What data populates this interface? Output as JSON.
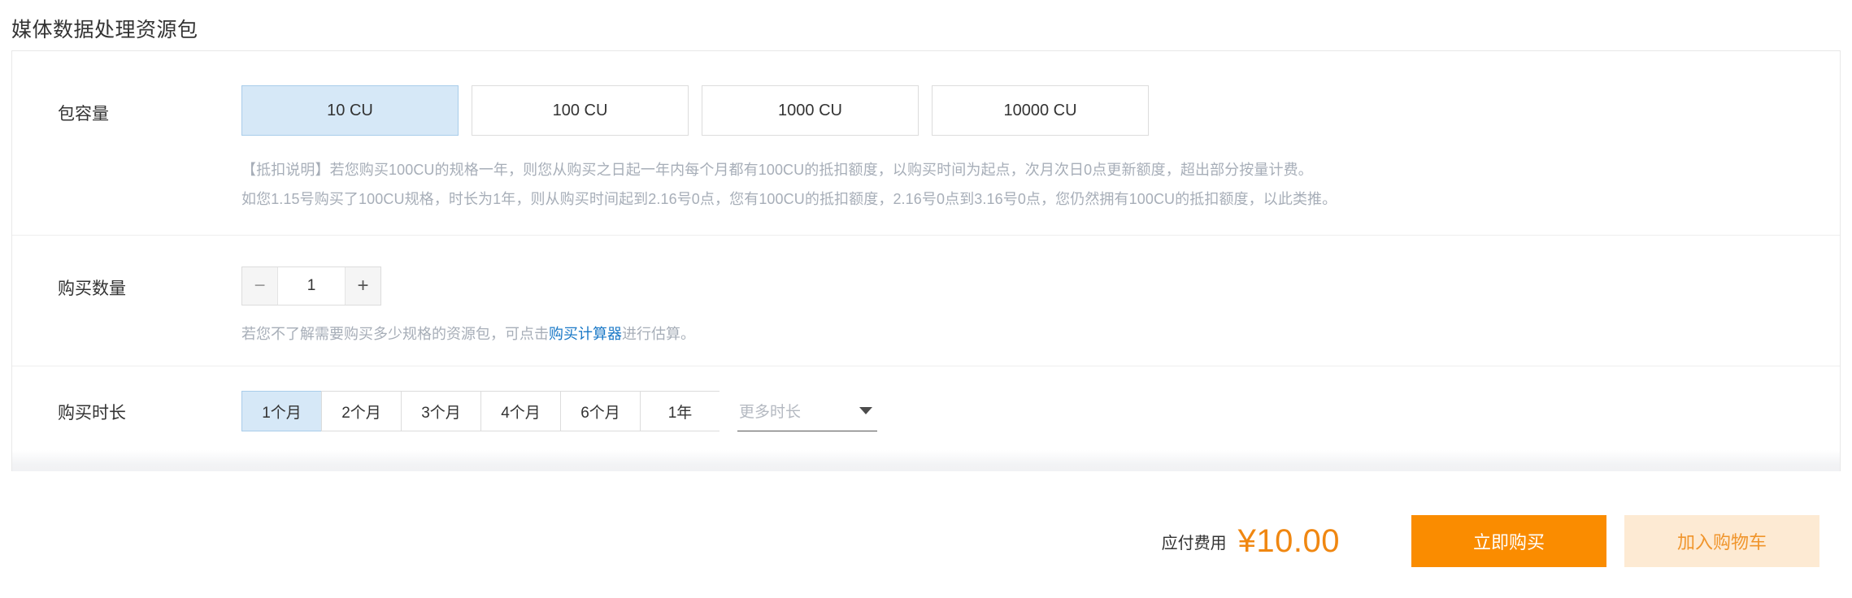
{
  "page": {
    "title": "媒体数据处理资源包"
  },
  "capacity": {
    "label": "包容量",
    "options": [
      {
        "label": "10 CU",
        "selected": true
      },
      {
        "label": "100 CU",
        "selected": false
      },
      {
        "label": "1000 CU",
        "selected": false
      },
      {
        "label": "10000 CU",
        "selected": false
      }
    ],
    "description_line1": "【抵扣说明】若您购买100CU的规格一年，则您从购买之日起一年内每个月都有100CU的抵扣额度，以购买时间为起点，次月次日0点更新额度，超出部分按量计费。",
    "description_line2": "如您1.15号购买了100CU规格，时长为1年，则从购买时间起到2.16号0点，您有100CU的抵扣额度，2.16号0点到3.16号0点，您仍然拥有100CU的抵扣额度，以此类推。"
  },
  "quantity": {
    "label": "购买数量",
    "value": "1",
    "decrease_icon": "minus-icon",
    "increase_icon": "plus-icon",
    "hint_prefix": "若您不了解需要购买多少规格的资源包，可点击",
    "hint_link": "购买计算器",
    "hint_suffix": "进行估算。"
  },
  "duration": {
    "label": "购买时长",
    "options": [
      {
        "label": "1个月",
        "selected": true
      },
      {
        "label": "2个月",
        "selected": false
      },
      {
        "label": "3个月",
        "selected": false
      },
      {
        "label": "4个月",
        "selected": false
      },
      {
        "label": "6个月",
        "selected": false
      },
      {
        "label": "1年",
        "selected": false
      }
    ],
    "more_label": "更多时长",
    "more_icon": "chevron-down-icon"
  },
  "footer": {
    "fee_label": "应付费用",
    "price": "¥10.00",
    "buy_now_label": "立即购买",
    "add_to_cart_label": "加入购物车"
  },
  "colors": {
    "accent_orange": "#fa8c00",
    "price_orange": "#f08711",
    "cart_bg": "#fdead3",
    "selected_blue": "#d6e8f7",
    "selected_border": "#a9cdea",
    "link_blue": "#1b79c7",
    "muted_text": "#a7aeb8"
  }
}
